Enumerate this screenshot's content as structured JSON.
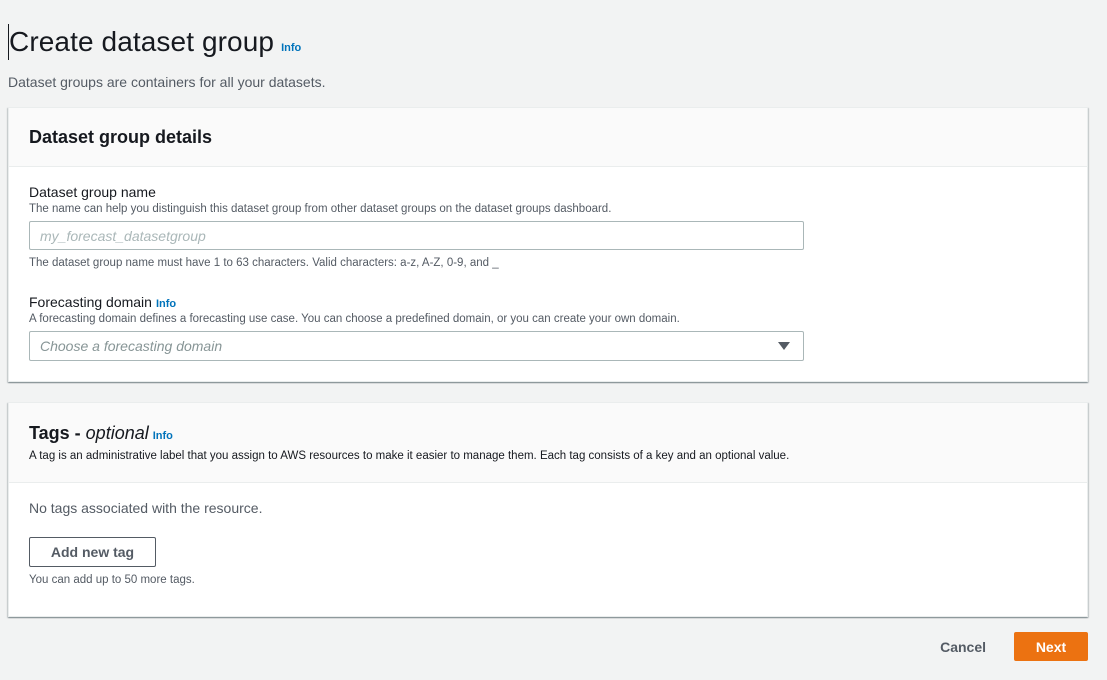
{
  "header": {
    "title": "Create dataset group",
    "info": "Info",
    "description": "Dataset groups are containers for all your datasets."
  },
  "details": {
    "title": "Dataset group details",
    "name_field": {
      "label": "Dataset group name",
      "description": "The name can help you distinguish this dataset group from other dataset groups on the dataset groups dashboard.",
      "value": "",
      "placeholder": "my_forecast_datasetgroup",
      "constraint": "The dataset group name must have 1 to 63 characters. Valid characters: a-z, A-Z, 0-9, and _"
    },
    "domain_field": {
      "label": "Forecasting domain",
      "info": "Info",
      "description": "A forecasting domain defines a forecasting use case. You can choose a predefined domain, or you can create your own domain.",
      "placeholder": "Choose a forecasting domain",
      "icon": "caret-down-icon"
    }
  },
  "tags": {
    "title": "Tags -",
    "optional": "optional",
    "info": "Info",
    "description": "A tag is an administrative label that you assign to AWS resources to make it easier to manage them. Each tag consists of a key and an optional value.",
    "empty_message": "No tags associated with the resource.",
    "add_button": "Add new tag",
    "limit_note": "You can add up to 50 more tags."
  },
  "footer": {
    "cancel": "Cancel",
    "next": "Next"
  },
  "colors": {
    "background": "#f2f3f3",
    "link": "#0073bb",
    "primary": "#ec7211",
    "text": "#16191f",
    "secondary_text": "#545b64"
  }
}
